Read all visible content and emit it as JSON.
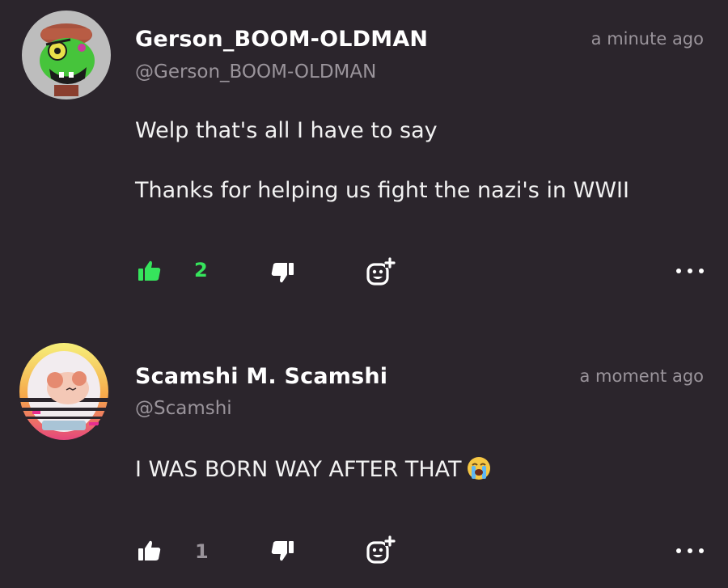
{
  "colors": {
    "background": "#2b252c",
    "liked_accent": "#36e45c",
    "muted_text": "#9a949b"
  },
  "comments": [
    {
      "author": "Gerson_BOOM-OLDMAN",
      "handle": "@Gerson_BOOM-OLDMAN",
      "time": "a minute ago",
      "body": [
        "Welp that's all I have to say",
        "Thanks for helping us fight the nazi's in WWII"
      ],
      "like_count": "2",
      "liked": true,
      "avatar": "green-frog-avatar"
    },
    {
      "author": "Scamshi M. Scamshi",
      "handle": "@Scamshi",
      "time": "a moment ago",
      "body": [
        "I WAS BORN WAY AFTER THAT"
      ],
      "body_emoji": "loudly-crying-face-emoji",
      "like_count": "1",
      "liked": false,
      "avatar": "retro-sun-cat-avatar"
    }
  ],
  "icons": {
    "like": "thumbs-up-icon",
    "dislike": "thumbs-down-icon",
    "react": "add-reaction-icon",
    "more": "more-options-icon"
  }
}
